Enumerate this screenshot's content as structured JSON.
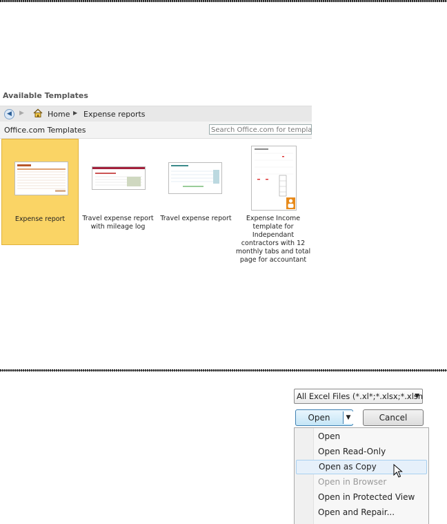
{
  "templates_panel": {
    "title": "Available Templates",
    "breadcrumb": {
      "home": "Home",
      "current": "Expense reports"
    },
    "subbar_label": "Office.com Templates",
    "search_placeholder": "Search Office.com for templates",
    "items": [
      {
        "caption": "Expense report",
        "selected": true
      },
      {
        "caption": "Travel expense report with mileage log",
        "selected": false
      },
      {
        "caption": "Travel expense report",
        "selected": false
      },
      {
        "caption": "Expense Income template for Independant contractors with 12 monthly tabs and total page for accountant",
        "selected": false
      }
    ]
  },
  "open_dialog": {
    "file_filter": "All Excel Files (*.xl*;*.xlsx;*.xlsm;",
    "open_label": "Open",
    "cancel_label": "Cancel",
    "menu": [
      {
        "label": "Open",
        "enabled": true
      },
      {
        "label": "Open Read-Only",
        "enabled": true
      },
      {
        "label": "Open as Copy",
        "enabled": true,
        "highlighted": true
      },
      {
        "label": "Open in Browser",
        "enabled": false
      },
      {
        "label": "Open in Protected View",
        "enabled": true
      },
      {
        "label": "Open and Repair...",
        "enabled": true
      }
    ]
  },
  "colors": {
    "selected_tile": "#fad465",
    "highlight": "#e6f0fa"
  }
}
